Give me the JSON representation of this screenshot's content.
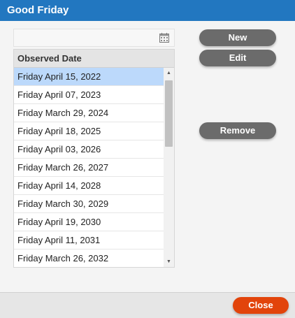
{
  "window": {
    "title": "Good Friday"
  },
  "table": {
    "column_header": "Observed Date",
    "rows": [
      "Friday April 15, 2022",
      "Friday April 07, 2023",
      "Friday March 29, 2024",
      "Friday April 18, 2025",
      "Friday April 03, 2026",
      "Friday March 26, 2027",
      "Friday April 14, 2028",
      "Friday March 30, 2029",
      "Friday April 19, 2030",
      "Friday April 11, 2031",
      "Friday March 26, 2032"
    ],
    "selected_index": 0
  },
  "buttons": {
    "new_label": "New",
    "edit_label": "Edit",
    "remove_label": "Remove",
    "close_label": "Close"
  },
  "icons": {
    "date_picker": "calendar-icon",
    "scroll_up": "scroll-up-arrow-icon",
    "scroll_down": "scroll-down-arrow-icon"
  },
  "colors": {
    "titlebar": "#2277c0",
    "selected_row": "#bcd9fb",
    "action_button": "#6b6b6b",
    "close_button": "#e2440b"
  }
}
